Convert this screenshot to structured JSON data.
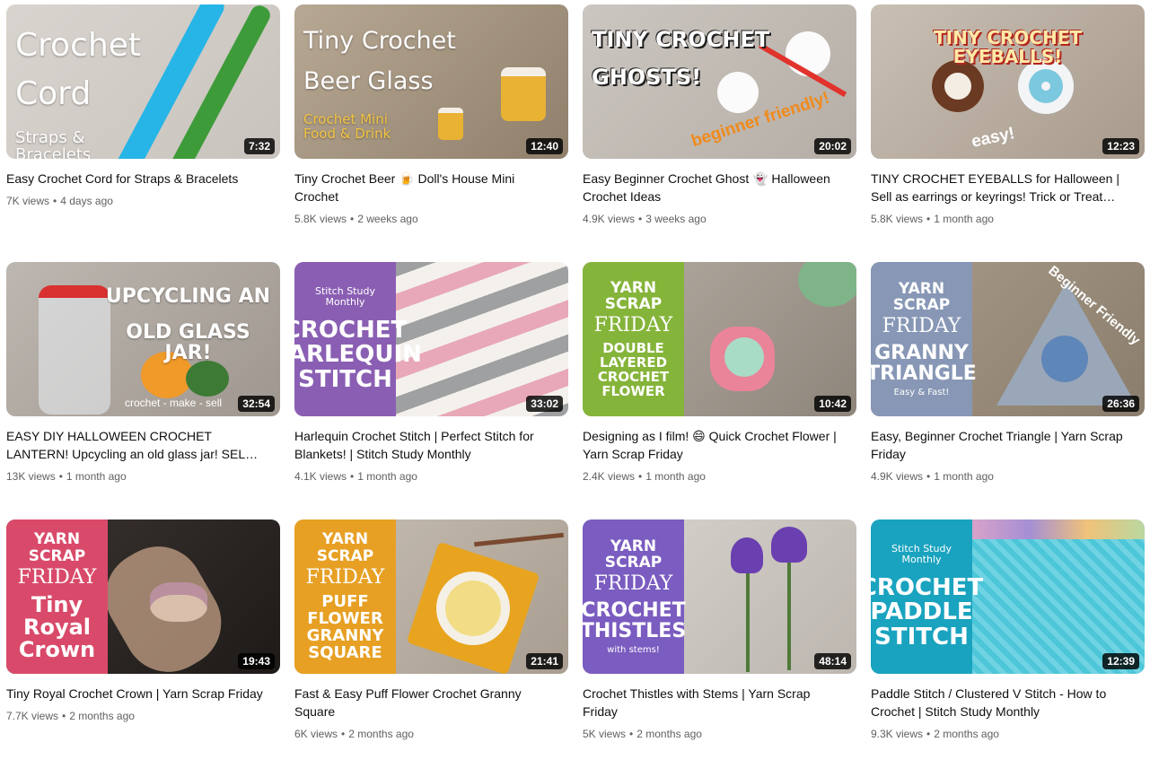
{
  "colors": {
    "title": "#0f0f0f",
    "meta": "#606060",
    "duration_bg": "#000000"
  },
  "videos": [
    {
      "thumb_lines": [
        "Crochet",
        "Cord"
      ],
      "thumb_sub": "Straps &\nBracelets",
      "duration": "7:32",
      "title": "Easy Crochet Cord for Straps & Bracelets",
      "views": "7K views",
      "age": "4 days ago"
    },
    {
      "thumb_lines": [
        "Tiny Crochet",
        "Beer Glass"
      ],
      "thumb_sub": "Crochet Mini\nFood & Drink",
      "duration": "12:40",
      "title": "Tiny Crochet Beer 🍺 Doll's House Mini Crochet",
      "views": "5.8K views",
      "age": "2 weeks ago"
    },
    {
      "thumb_lines": [
        "TINY CROCHET",
        "GHOSTS!"
      ],
      "thumb_sub": "beginner friendly!",
      "duration": "20:02",
      "title": "Easy Beginner Crochet Ghost 👻 Halloween Crochet Ideas",
      "views": "4.9K views",
      "age": "3 weeks ago"
    },
    {
      "thumb_lines": [
        "TINY CROCHET EYEBALLS!"
      ],
      "thumb_sub": "easy!",
      "duration": "12:23",
      "title": "TINY CROCHET EYEBALLS for Halloween | Sell as earrings or keyrings! Trick or Treat…",
      "views": "5.8K views",
      "age": "1 month ago"
    },
    {
      "thumb_lines": [
        "UPCYCLING AN",
        "OLD GLASS JAR!"
      ],
      "thumb_sub": "crochet - make - sell",
      "duration": "32:54",
      "title": "EASY DIY HALLOWEEN CROCHET LANTERN! Upcycling an old glass jar! SELL your…",
      "views": "13K views",
      "age": "1 month ago"
    },
    {
      "panel_top": "Stitch Study Monthly",
      "panel_script": "",
      "panel_main": "CROCHET\nHARLEQUIN\nSTITCH",
      "panel_small": "",
      "duration": "33:02",
      "title": "Harlequin Crochet Stitch | Perfect Stitch for Blankets! | Stitch Study Monthly",
      "views": "4.1K views",
      "age": "1 month ago"
    },
    {
      "panel_top": "YARN SCRAP",
      "panel_script": "FRIDAY",
      "panel_main": "DOUBLE LAYERED\nCROCHET\nFLOWER",
      "panel_small": "",
      "duration": "10:42",
      "title": "Designing as I film! 😄 Quick Crochet Flower | Yarn Scrap Friday",
      "views": "2.4K views",
      "age": "1 month ago"
    },
    {
      "panel_top": "YARN SCRAP",
      "panel_script": "FRIDAY",
      "panel_main": "GRANNY\nTRIANGLE",
      "panel_small": "Easy & Fast!",
      "thumb_sub": "Beginner Friendly",
      "duration": "26:36",
      "title": "Easy, Beginner Crochet Triangle | Yarn Scrap Friday",
      "views": "4.9K views",
      "age": "1 month ago"
    },
    {
      "panel_top": "YARN SCRAP",
      "panel_script": "FRIDAY",
      "panel_main": "Tiny Royal\nCrown",
      "panel_small": "",
      "duration": "19:43",
      "title": "Tiny Royal Crochet Crown | Yarn Scrap Friday",
      "views": "7.7K views",
      "age": "2 months ago"
    },
    {
      "panel_top": "YARN SCRAP",
      "panel_script": "FRIDAY",
      "panel_main": "PUFF FLOWER\nGRANNY\nSQUARE",
      "panel_small": "",
      "duration": "21:41",
      "title": "Fast & Easy Puff Flower Crochet Granny Square",
      "views": "6K views",
      "age": "2 months ago"
    },
    {
      "panel_top": "YARN SCRAP",
      "panel_script": "FRIDAY",
      "panel_main": "CROCHET\nTHISTLES",
      "panel_small": "with stems!",
      "duration": "48:14",
      "title": "Crochet Thistles with Stems | Yarn Scrap Friday",
      "views": "5K views",
      "age": "2 months ago"
    },
    {
      "panel_top": "Stitch Study Monthly",
      "panel_script": "",
      "panel_main": "CROCHET\nPADDLE\nSTITCH",
      "panel_small": "",
      "duration": "12:39",
      "title": "Paddle Stitch / Clustered V Stitch - How to Crochet | Stitch Study Monthly",
      "views": "9.3K views",
      "age": "2 months ago"
    }
  ]
}
